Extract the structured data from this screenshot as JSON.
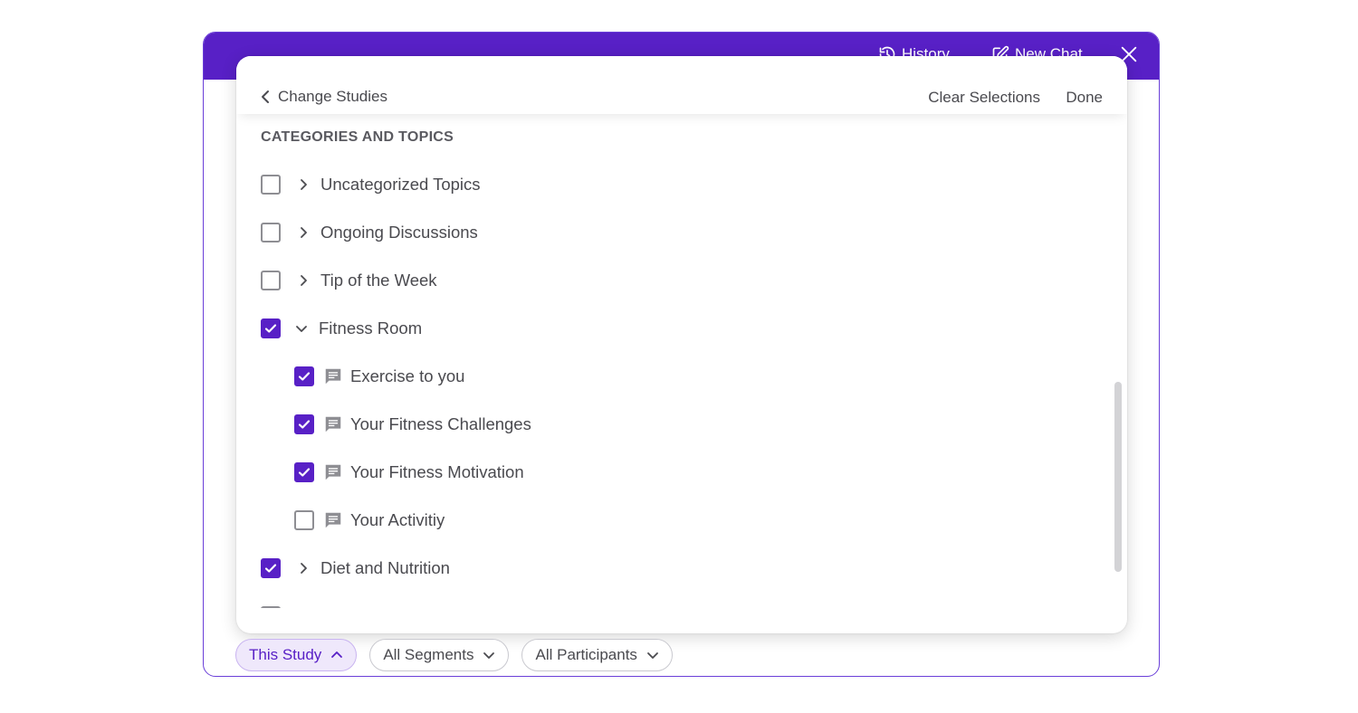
{
  "header": {
    "history_label": "History",
    "new_chat_label": "New Chat",
    "bg_color": "#5820c6"
  },
  "popover": {
    "back_label": "Change Studies",
    "clear_label": "Clear Selections",
    "done_label": "Done",
    "section_title": "CATEGORIES AND TOPICS",
    "items": [
      {
        "label": "Uncategorized Topics",
        "checked": false,
        "expandable": true,
        "expanded": false
      },
      {
        "label": "Ongoing Discussions",
        "checked": false,
        "expandable": true,
        "expanded": false
      },
      {
        "label": "Tip of the Week",
        "checked": false,
        "expandable": true,
        "expanded": false
      },
      {
        "label": "Fitness Room",
        "checked": true,
        "expandable": true,
        "expanded": true,
        "children": [
          {
            "label": "Exercise to you",
            "checked": true
          },
          {
            "label": "Your Fitness Challenges",
            "checked": true
          },
          {
            "label": "Your Fitness Motivation",
            "checked": true
          },
          {
            "label": "Your Activitiy",
            "checked": false
          }
        ]
      },
      {
        "label": "Diet and Nutrition",
        "checked": true,
        "expandable": true,
        "expanded": false
      }
    ]
  },
  "filters": {
    "study_label": "This Study",
    "segments_label": "All Segments",
    "participants_label": "All Participants"
  },
  "colors": {
    "accent": "#5820c6",
    "text": "#4a4a4f",
    "chip_active_bg": "#efe8fb"
  }
}
